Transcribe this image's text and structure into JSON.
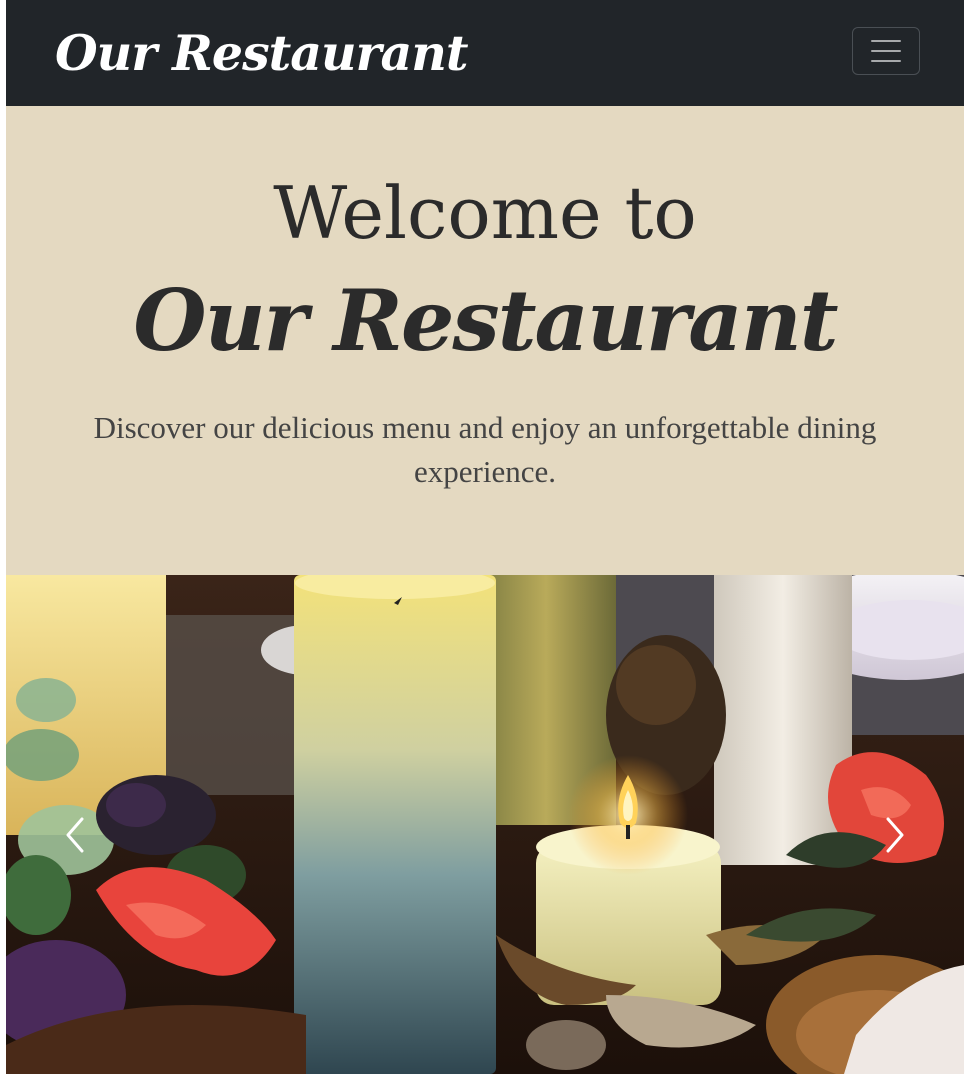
{
  "navbar": {
    "brand": "Our Restaurant",
    "toggler_icon": "hamburger-menu-icon"
  },
  "hero": {
    "welcome": "Welcome to",
    "name": "Our Restaurant",
    "tagline": "Discover our delicious menu and enjoy an unforgettable dining experience."
  },
  "carousel": {
    "prev_icon": "chevron-left-icon",
    "next_icon": "chevron-right-icon"
  },
  "colors": {
    "navbar_bg": "#212529",
    "hero_bg": "#e4d9c1",
    "text_dark": "#2b2b2b"
  }
}
